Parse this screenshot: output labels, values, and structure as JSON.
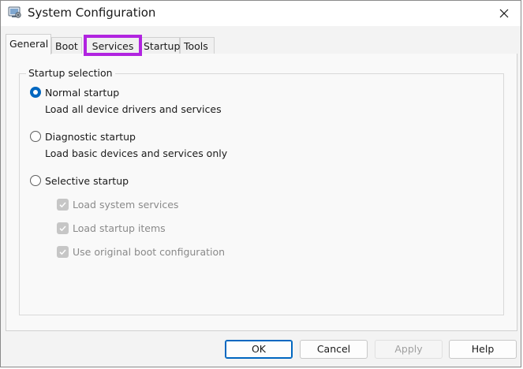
{
  "window": {
    "title": "System Configuration"
  },
  "tabs": [
    {
      "label": "General",
      "active": true
    },
    {
      "label": "Boot"
    },
    {
      "label": "Services",
      "highlighted": true
    },
    {
      "label": "Startup"
    },
    {
      "label": "Tools"
    }
  ],
  "startup_selection": {
    "group_label": "Startup selection",
    "normal": {
      "label": "Normal startup",
      "description": "Load all device drivers and services",
      "selected": true
    },
    "diagnostic": {
      "label": "Diagnostic startup",
      "description": "Load basic devices and services only",
      "selected": false
    },
    "selective": {
      "label": "Selective startup",
      "selected": false,
      "options": [
        {
          "label": "Load system services",
          "checked": true,
          "disabled": true
        },
        {
          "label": "Load startup items",
          "checked": true,
          "disabled": true
        },
        {
          "label": "Use original boot configuration",
          "checked": true,
          "disabled": true
        }
      ]
    }
  },
  "buttons": {
    "ok": "OK",
    "cancel": "Cancel",
    "apply": "Apply",
    "help": "Help"
  },
  "colors": {
    "accent": "#0067c0",
    "highlight_box": "#b124e0"
  },
  "icons": {
    "app": "system-configuration-icon",
    "close": "close-icon",
    "check": "check-icon"
  }
}
